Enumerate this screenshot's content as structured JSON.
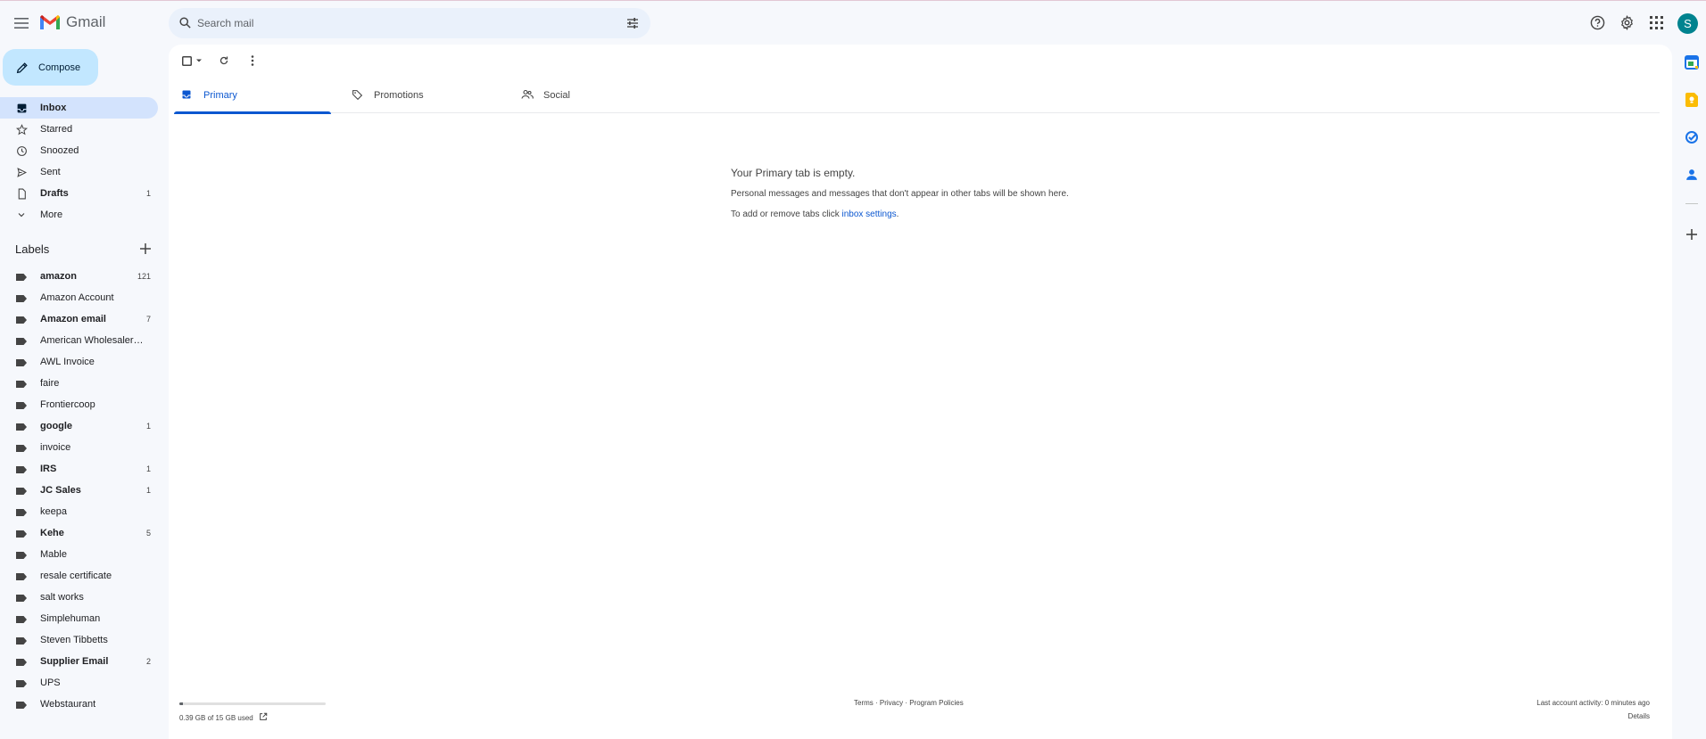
{
  "app": {
    "name": "Gmail"
  },
  "search": {
    "placeholder": "Search mail"
  },
  "user": {
    "avatar_letter": "S",
    "avatar_color": "#00838f"
  },
  "compose": {
    "label": "Compose"
  },
  "nav": {
    "items": [
      {
        "label": "Inbox",
        "count": "",
        "icon": "inbox-icon",
        "active": true
      },
      {
        "label": "Starred",
        "count": "",
        "icon": "star-icon"
      },
      {
        "label": "Snoozed",
        "count": "",
        "icon": "clock-icon"
      },
      {
        "label": "Sent",
        "count": "",
        "icon": "send-icon"
      },
      {
        "label": "Drafts",
        "count": "1",
        "icon": "draft-icon"
      },
      {
        "label": "More",
        "count": "",
        "icon": "chevron-down-icon"
      }
    ]
  },
  "labels": {
    "heading": "Labels",
    "items": [
      {
        "label": "amazon",
        "count": "121"
      },
      {
        "label": "Amazon Account",
        "count": ""
      },
      {
        "label": "Amazon email",
        "count": "7"
      },
      {
        "label": "American Wholesaler S...",
        "count": ""
      },
      {
        "label": "AWL Invoice",
        "count": ""
      },
      {
        "label": "faire",
        "count": ""
      },
      {
        "label": "Frontiercoop",
        "count": ""
      },
      {
        "label": "google",
        "count": "1"
      },
      {
        "label": "invoice",
        "count": ""
      },
      {
        "label": "IRS",
        "count": "1"
      },
      {
        "label": "JC Sales",
        "count": "1"
      },
      {
        "label": "keepa",
        "count": ""
      },
      {
        "label": "Kehe",
        "count": "5"
      },
      {
        "label": "Mable",
        "count": ""
      },
      {
        "label": "resale certificate",
        "count": ""
      },
      {
        "label": "salt works",
        "count": ""
      },
      {
        "label": "Simplehuman",
        "count": ""
      },
      {
        "label": "Steven Tibbetts",
        "count": ""
      },
      {
        "label": "Supplier Email",
        "count": "2"
      },
      {
        "label": "UPS",
        "count": ""
      },
      {
        "label": "Webstaurant",
        "count": ""
      }
    ]
  },
  "tabs": [
    {
      "label": "Primary",
      "icon": "inbox-icon",
      "active": true
    },
    {
      "label": "Promotions",
      "icon": "tag-icon"
    },
    {
      "label": "Social",
      "icon": "people-icon"
    }
  ],
  "empty": {
    "title": "Your Primary tab is empty.",
    "line1": "Personal messages and messages that don't appear in other tabs will be shown here.",
    "line2_prefix": "To add or remove tabs click ",
    "line2_link": "inbox settings",
    "line2_suffix": "."
  },
  "footer": {
    "storage_text": "0.39 GB of 15 GB used",
    "storage_fraction": 0.026,
    "links": "Terms · Privacy · Program Policies",
    "activity": "Last account activity: 0 minutes ago",
    "details": "Details"
  },
  "colors": {
    "accent": "#0b57d0",
    "compose_bg": "#c2e7ff",
    "active_nav": "#d3e3fd",
    "page_bg": "#f6f8fc"
  }
}
